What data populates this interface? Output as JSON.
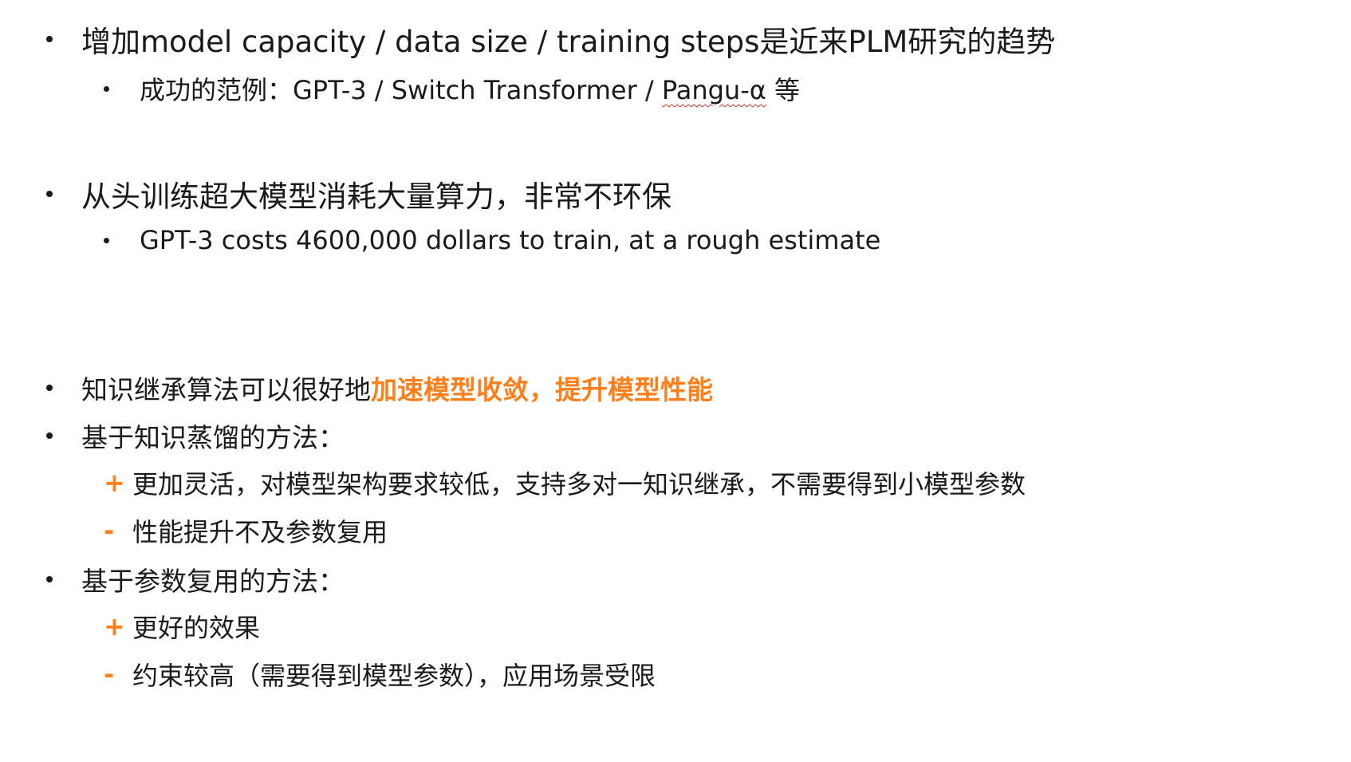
{
  "slide": {
    "sections": [
      {
        "bullet": "•",
        "text": "增加model capacity / data size / training steps是近来PLM研究的趋势",
        "sub": {
          "bullet": "•",
          "prefix": "成功的范例：GPT-3 / Switch Transformer / ",
          "flagged_word": "Pangu-α",
          "suffix": " 等"
        }
      },
      {
        "bullet": "•",
        "text": "从头训练超大模型消耗大量算力，非常不环保",
        "sub": {
          "bullet": "•",
          "text": "GPT-3 costs 4600,000 dollars to train, at a rough estimate"
        }
      },
      {
        "bullet": "•",
        "text_plain": "知识继承算法可以很好地",
        "text_highlight": "加速模型收敛，提升模型性能"
      },
      {
        "bullet": "•",
        "text": "基于知识蒸馏的方法：",
        "items": [
          {
            "sign": "+",
            "text": "更加灵活，对模型架构要求较低，支持多对一知识继承，不需要得到小模型参数"
          },
          {
            "sign": "-",
            "text": "性能提升不及参数复用"
          }
        ]
      },
      {
        "bullet": "•",
        "text": "基于参数复用的方法：",
        "items": [
          {
            "sign": "+",
            "text": "更好的效果"
          },
          {
            "sign": "-",
            "text": "约束较高（需要得到模型参数），应用场景受限"
          }
        ]
      }
    ]
  },
  "colors": {
    "accent": "#ff7f1a",
    "text": "#1a1a1a",
    "spellcheck": "#d03030"
  }
}
